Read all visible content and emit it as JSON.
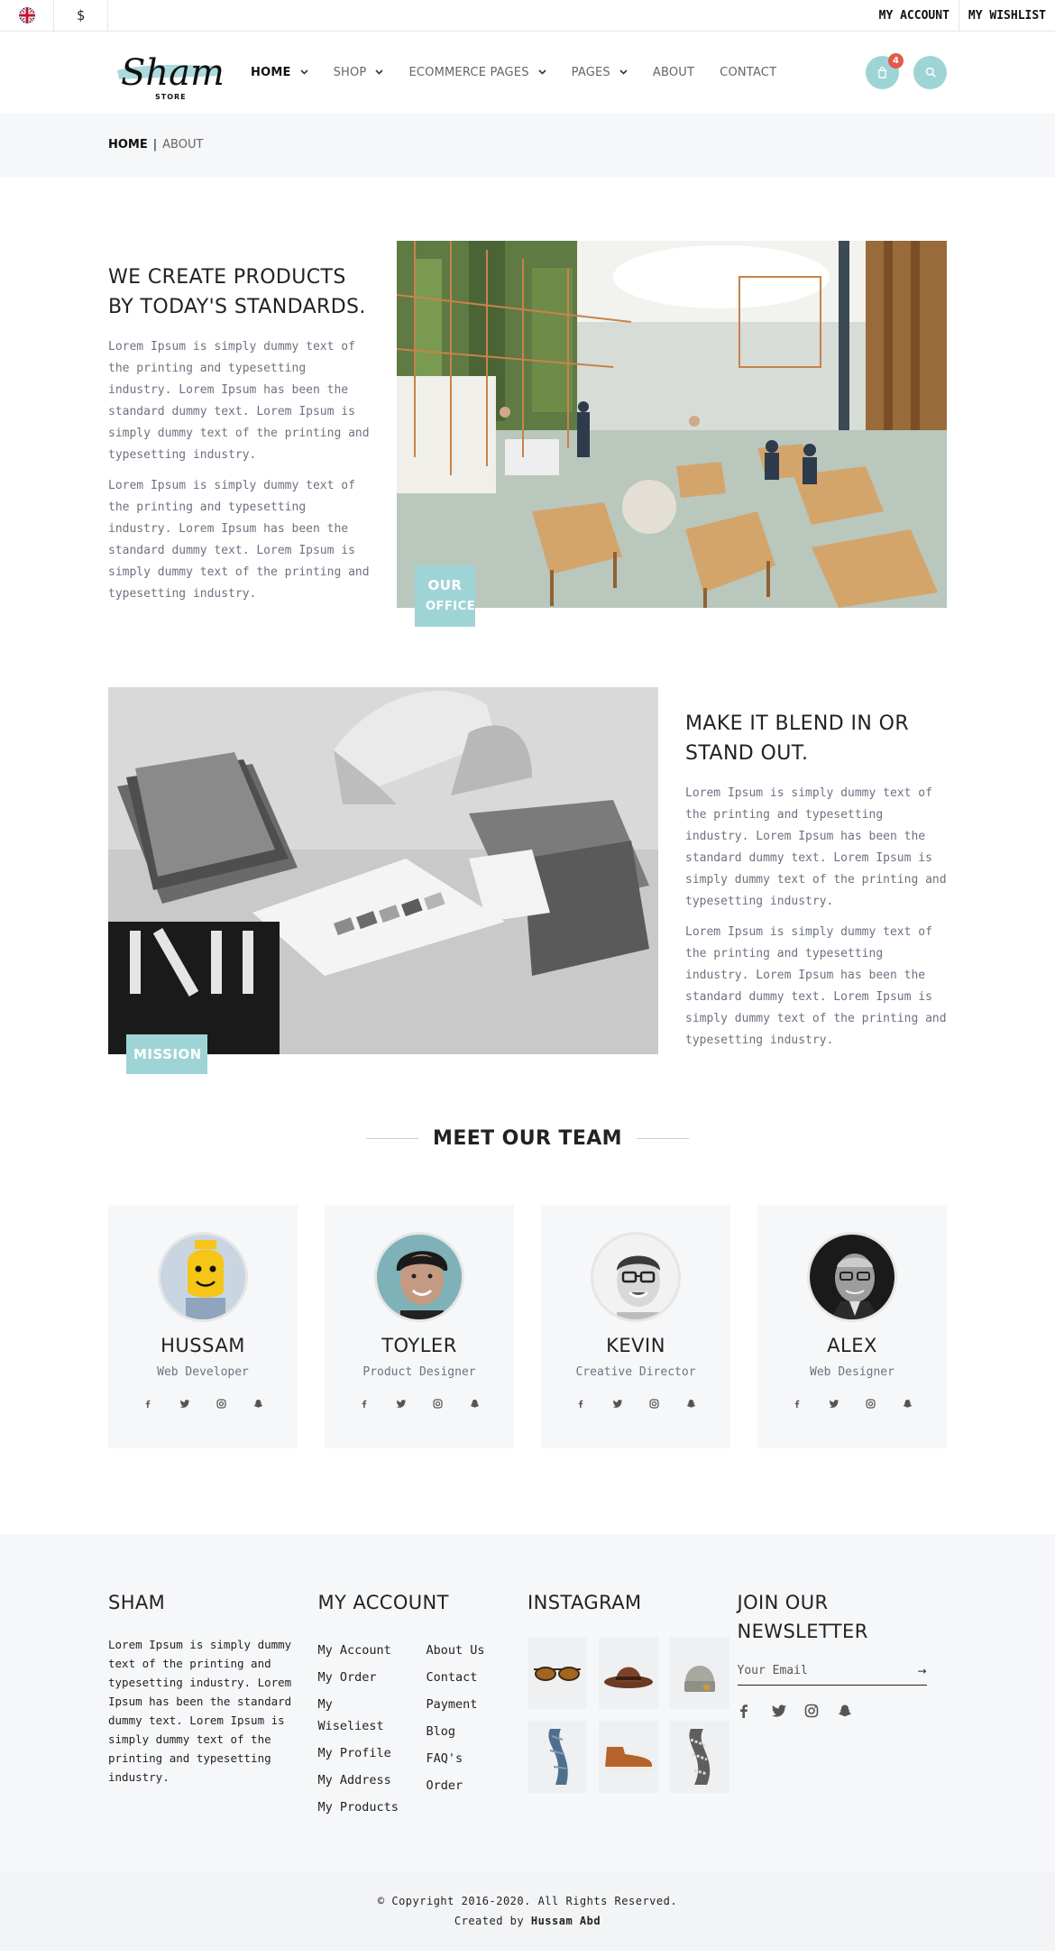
{
  "topbar": {
    "currency": "$",
    "my_account": "MY ACCOUNT",
    "my_wishlist": "MY WISHLIST"
  },
  "logo": {
    "script": "Sham",
    "sub": "STORE"
  },
  "nav": [
    {
      "label": "HOME",
      "dropdown": true,
      "active": true
    },
    {
      "label": "SHOP",
      "dropdown": true
    },
    {
      "label": "ECOMMERCE PAGES",
      "dropdown": true
    },
    {
      "label": "PAGES",
      "dropdown": true
    },
    {
      "label": "ABOUT",
      "dropdown": false
    },
    {
      "label": "CONTACT",
      "dropdown": false
    }
  ],
  "cart": {
    "count": "4",
    "icon": "bag-icon"
  },
  "search": {
    "icon": "search-icon"
  },
  "breadcrumb": {
    "home": "HOME",
    "separator": "|",
    "current": "ABOUT"
  },
  "section1": {
    "title": "WE CREATE PRODUCTS BY TODAY'S STANDARDS.",
    "paragraphs": [
      "Lorem Ipsum is simply dummy text of the printing and typesetting industry. Lorem Ipsum has been the standard dummy text. Lorem Ipsum is simply dummy text of the printing and typesetting industry.",
      "Lorem Ipsum is simply dummy text of the printing and typesetting industry. Lorem Ipsum has been the standard dummy text. Lorem Ipsum is simply dummy text of the printing and typesetting industry."
    ],
    "label_line1": "OUR",
    "label_line2": "OFFICE"
  },
  "section2": {
    "title": "MAKE IT BLEND IN OR STAND OUT.",
    "paragraphs": [
      "Lorem Ipsum is simply dummy text of the printing and typesetting industry. Lorem Ipsum has been the standard dummy text. Lorem Ipsum is simply dummy text of the printing and typesetting industry.",
      "Lorem Ipsum is simply dummy text of the printing and typesetting industry. Lorem Ipsum has been the standard dummy text. Lorem Ipsum is simply dummy text of the printing and typesetting industry."
    ],
    "label": "MISSION"
  },
  "team": {
    "title": "MEET OUR TEAM",
    "members": [
      {
        "name": "HUSSAM",
        "role": "Web Developer"
      },
      {
        "name": "TOYLER",
        "role": "Product Designer"
      },
      {
        "name": "KEVIN",
        "role": "Creative Director"
      },
      {
        "name": "ALEX",
        "role": "Web Designer"
      }
    ],
    "social_icons": [
      "facebook-icon",
      "twitter-icon",
      "instagram-icon",
      "snapchat-icon"
    ]
  },
  "footer": {
    "about_title": "SHAM",
    "about_text": "Lorem Ipsum is simply dummy text of the printing and typesetting industry. Lorem Ipsum has been the standard dummy text. Lorem Ipsum is simply dummy text of the printing and typesetting industry.",
    "account_title": "MY ACCOUNT",
    "account_links": [
      "My Account",
      "My Order",
      "My Wiseliest",
      "My Profile",
      "My Address",
      "My Products"
    ],
    "info_links": [
      "About Us",
      "Contact",
      "Payment",
      "Blog",
      "FAQ's",
      "Order"
    ],
    "instagram_title": "INSTAGRAM",
    "newsletter_title": "JOIN OUR NEWSLETTER",
    "email_placeholder": "Your Email"
  },
  "copyright": {
    "line1": "© Copyright 2016-2020. All Rights Reserved.",
    "line2_prefix": "Created by",
    "author": "Hussam Abd"
  },
  "colors": {
    "accent": "#9fd4d6",
    "badge": "#e35a4a",
    "light_bg": "#f6f7f9"
  }
}
